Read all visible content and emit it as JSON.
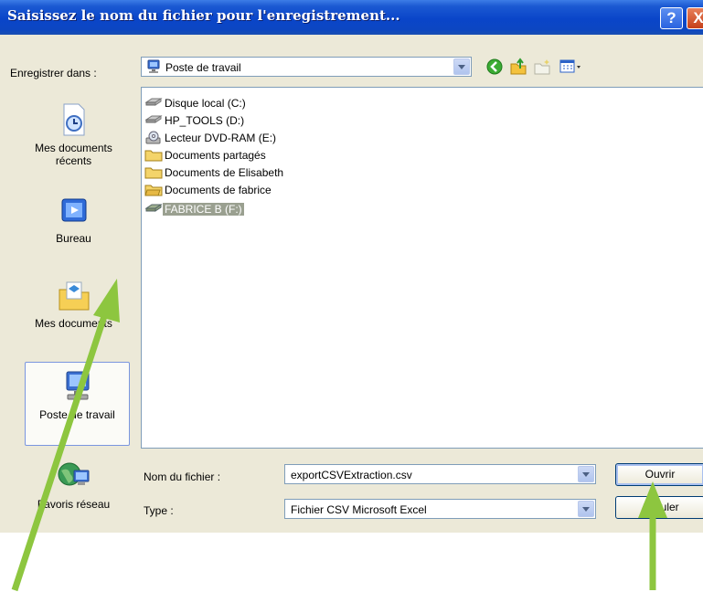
{
  "window": {
    "title": "Saisissez le nom du fichier pour l'enregistrement...",
    "help_glyph": "?",
    "close_glyph": "X"
  },
  "toolbar": {
    "save_in_label": "Enregistrer dans :",
    "save_in_value": "Poste de travail",
    "icons": [
      "back-icon",
      "up-folder-icon",
      "new-folder-icon",
      "views-menu-icon"
    ]
  },
  "places": [
    {
      "label": "Mes documents récents",
      "icon": "recent-documents-icon"
    },
    {
      "label": "Bureau",
      "icon": "desktop-icon"
    },
    {
      "label": "Mes documents",
      "icon": "my-documents-icon"
    },
    {
      "label": "Poste de travail",
      "icon": "my-computer-icon",
      "selected": true
    },
    {
      "label": "Favoris réseau",
      "icon": "network-places-icon"
    }
  ],
  "files": [
    {
      "name": "Disque local (C:)",
      "icon": "drive-icon"
    },
    {
      "name": "HP_TOOLS (D:)",
      "icon": "drive-icon"
    },
    {
      "name": "Lecteur DVD-RAM (E:)",
      "icon": "dvd-icon"
    },
    {
      "name": "Documents partagés",
      "icon": "folder-icon"
    },
    {
      "name": "Documents de Elisabeth",
      "icon": "folder-icon"
    },
    {
      "name": "Documents de fabrice",
      "icon": "folder-icon"
    },
    {
      "name": "FABRICE B (F:)",
      "icon": "removable-drive-icon",
      "selected": true
    }
  ],
  "filename": {
    "label": "Nom du fichier :",
    "value": "exportCSVExtraction.csv"
  },
  "filetype": {
    "label": "Type :",
    "value": "Fichier CSV Microsoft Excel"
  },
  "buttons": {
    "save": "Ouvrir",
    "cancel": "Annuler"
  },
  "colors": {
    "title_bar": "#0a45c9",
    "dialog_bg": "#ece9d8",
    "annotation_arrow": "#8dc63f",
    "selection": "#9aa090"
  }
}
